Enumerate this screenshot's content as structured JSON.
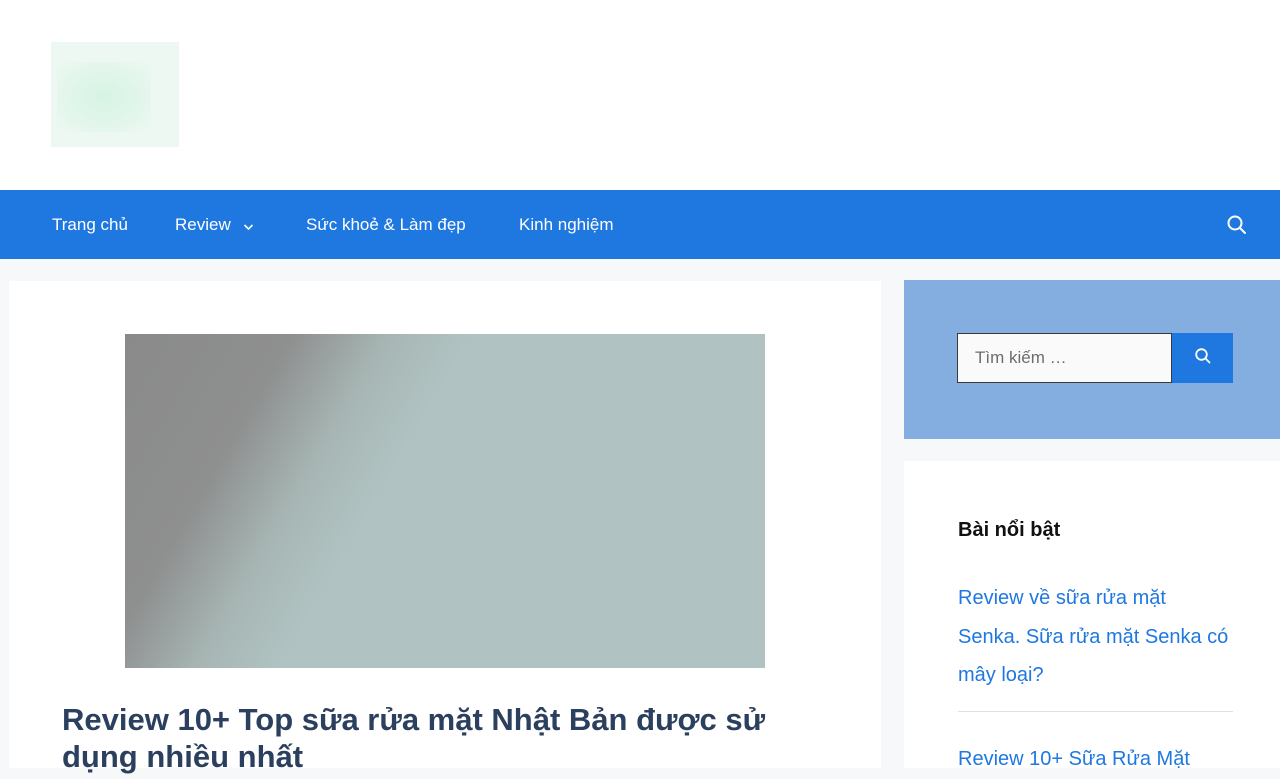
{
  "nav": {
    "items": [
      {
        "label": "Trang chủ"
      },
      {
        "label": "Review"
      },
      {
        "label": "Sức khoẻ & Làm đẹp"
      },
      {
        "label": "Kinh nghiệm"
      }
    ]
  },
  "post": {
    "title": "Review 10+ Top sữa rửa mặt Nhật Bản được sử dụng nhiều nhất"
  },
  "sidebar": {
    "search": {
      "placeholder": "Tìm kiếm …"
    },
    "featured": {
      "title": "Bài nổi bật",
      "links": [
        {
          "text": "Review về sữa rửa mặt Senka. Sữa rửa mặt Senka có mây loại?"
        },
        {
          "text": "Review 10+ Sữa Rửa Mặt"
        }
      ]
    }
  },
  "colors": {
    "nav_bg": "#1e78e0",
    "link": "#1e78e0",
    "title": "#2b3f5e",
    "search_widget_bg": "#84aee0"
  },
  "icons": {
    "nav_search": "search-icon",
    "dropdown": "chevron-down-icon",
    "search_button": "search-icon"
  }
}
